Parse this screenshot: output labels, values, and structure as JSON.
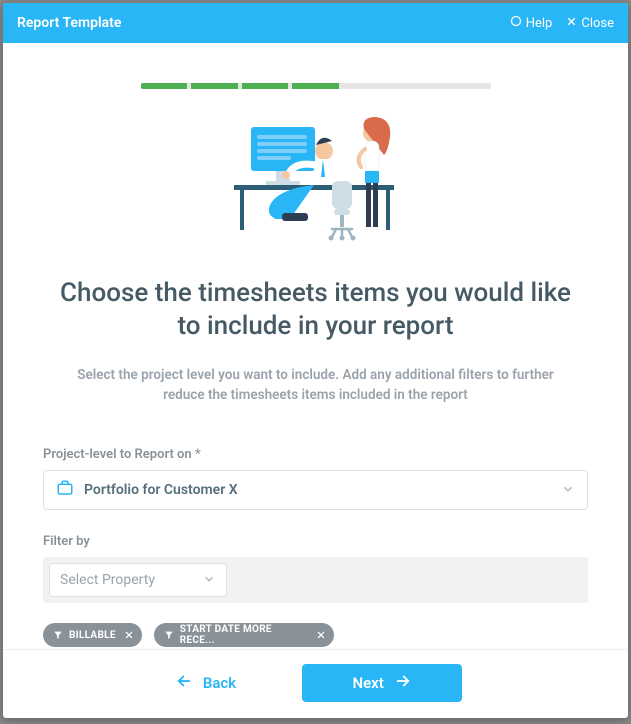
{
  "header": {
    "title": "Report Template",
    "help_label": "Help",
    "close_label": "Close"
  },
  "progress": {
    "total_steps": 7,
    "completed_steps": 4
  },
  "main": {
    "heading": "Choose the timesheets items you would like to include in your report",
    "sub": "Select the project level you want to include. Add any additional filters to further reduce the timesheets items included in the report"
  },
  "project_level": {
    "label": "Project-level to Report on *",
    "value": "Portfolio for Customer X"
  },
  "filter": {
    "label": "Filter by",
    "placeholder": "Select Property",
    "chips": [
      {
        "label": "BILLABLE"
      },
      {
        "label": "START DATE MORE RECE..."
      }
    ]
  },
  "footer": {
    "back": "Back",
    "next": "Next"
  },
  "colors": {
    "primary": "#29b6f6",
    "progress_done": "#4caf50"
  }
}
